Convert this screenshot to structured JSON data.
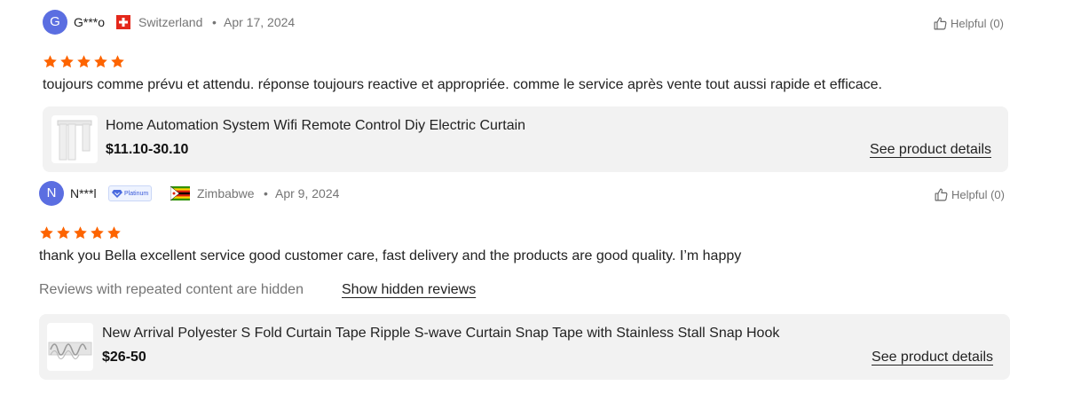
{
  "colors": {
    "avatar": "#5b6ee1",
    "star": "#fd6400",
    "card_bg": "#f2f2f2"
  },
  "reviews": [
    {
      "initial": "G",
      "name": "G***o",
      "country": "Switzerland",
      "flag": "swiss-flag-icon",
      "date": "Apr 17, 2024",
      "helpful": "Helpful (0)",
      "rating": 5,
      "text": "toujours comme prévu et attendu. réponse toujours reactive et appropriée. comme le service après vente tout aussi rapide et efficace.",
      "product": {
        "title": "Home Automation System Wifi Remote Control Diy Electric Curtain",
        "price": "$11.10-30.10",
        "details_label": "See product details"
      }
    },
    {
      "initial": "N",
      "name": "N***l",
      "badge": "Platinum",
      "country": "Zimbabwe",
      "flag": "zimbabwe-flag-icon",
      "date": "Apr 9, 2024",
      "helpful": "Helpful (0)",
      "rating": 5,
      "text": "thank you Bella excellent service good customer care, fast delivery and the products are good quality. I’m happy",
      "hidden_note": "Reviews with repeated content are hidden",
      "show_hidden_label": "Show hidden reviews",
      "product": {
        "title": "New Arrival Polyester S Fold Curtain Tape Ripple S-wave Curtain Snap Tape with Stainless Stall Snap Hook",
        "price": "$26-50",
        "details_label": "See product details"
      }
    }
  ]
}
